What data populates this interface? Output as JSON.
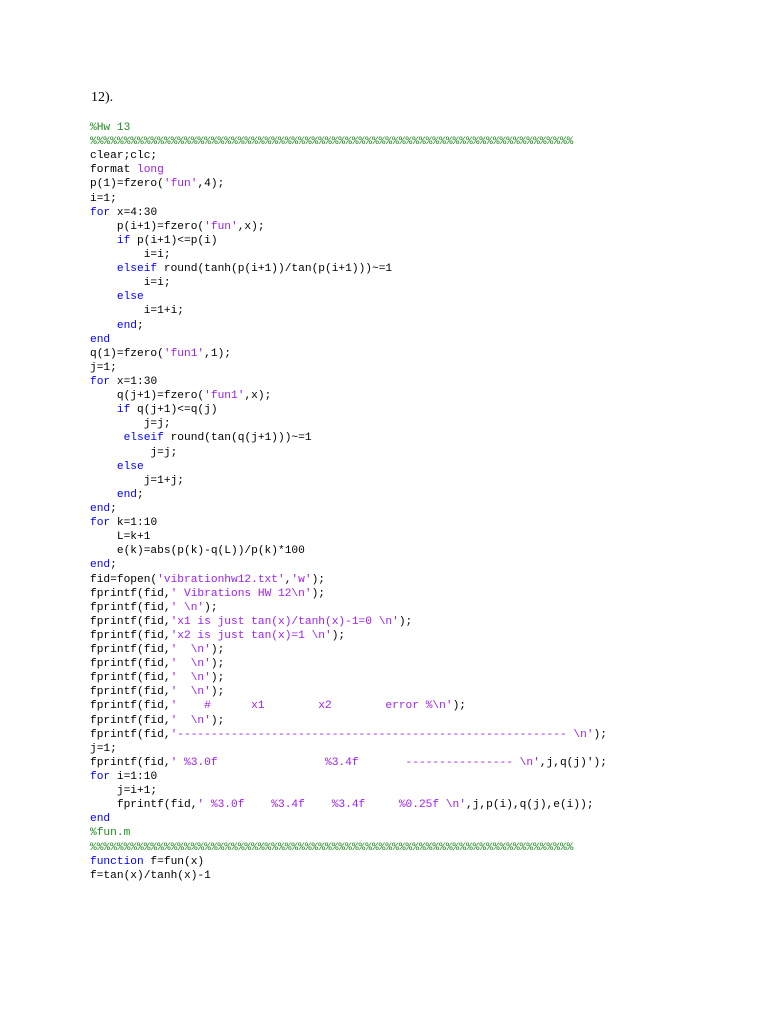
{
  "document": {
    "heading": "12).",
    "colors": {
      "keyword": "#0000ff",
      "string": "#a020f0",
      "comment": "#228b22",
      "text": "#000000"
    },
    "code_lines": [
      [
        [
          "c",
          "%Hw 13"
        ]
      ],
      [
        [
          "c",
          "%%%%%%%%%%%%%%%%%%%%%%%%%%%%%%%%%%%%%%%%%%%%%%%%%%%%%%%%%%%%%%%%%%%%%%%%"
        ]
      ],
      [
        [
          "n",
          "clear;clc;"
        ]
      ],
      [
        [
          "n",
          "format "
        ],
        [
          "s",
          "long"
        ]
      ],
      [
        [
          "n",
          "p(1)=fzero("
        ],
        [
          "s",
          "'fun'"
        ],
        [
          "n",
          ",4);"
        ]
      ],
      [
        [
          "n",
          "i=1;"
        ]
      ],
      [
        [
          "k",
          "for"
        ],
        [
          "n",
          " x=4:30"
        ]
      ],
      [
        [
          "n",
          "    p(i+1)=fzero("
        ],
        [
          "s",
          "'fun'"
        ],
        [
          "n",
          ",x);"
        ]
      ],
      [
        [
          "n",
          "    "
        ],
        [
          "k",
          "if"
        ],
        [
          "n",
          " p(i+1)<=p(i)"
        ]
      ],
      [
        [
          "n",
          "        i=i;"
        ]
      ],
      [
        [
          "n",
          "    "
        ],
        [
          "k",
          "elseif"
        ],
        [
          "n",
          " round(tanh(p(i+1))/tan(p(i+1)))~=1"
        ]
      ],
      [
        [
          "n",
          "        i=i;"
        ]
      ],
      [
        [
          "n",
          "    "
        ],
        [
          "k",
          "else"
        ]
      ],
      [
        [
          "n",
          "        i=1+i;"
        ]
      ],
      [
        [
          "n",
          "    "
        ],
        [
          "k",
          "end"
        ],
        [
          "n",
          ";"
        ]
      ],
      [
        [
          "k",
          "end"
        ]
      ],
      [
        [
          "n",
          "q(1)=fzero("
        ],
        [
          "s",
          "'fun1'"
        ],
        [
          "n",
          ",1);"
        ]
      ],
      [
        [
          "n",
          "j=1;"
        ]
      ],
      [
        [
          "k",
          "for"
        ],
        [
          "n",
          " x=1:30"
        ]
      ],
      [
        [
          "n",
          "    q(j+1)=fzero("
        ],
        [
          "s",
          "'fun1'"
        ],
        [
          "n",
          ",x);"
        ]
      ],
      [
        [
          "n",
          "    "
        ],
        [
          "k",
          "if"
        ],
        [
          "n",
          " q(j+1)<=q(j)"
        ]
      ],
      [
        [
          "n",
          "        j=j;"
        ]
      ],
      [
        [
          "n",
          "     "
        ],
        [
          "k",
          "elseif"
        ],
        [
          "n",
          " round(tan(q(j+1)))~=1"
        ]
      ],
      [
        [
          "n",
          "         j=j;"
        ]
      ],
      [
        [
          "n",
          "    "
        ],
        [
          "k",
          "else"
        ]
      ],
      [
        [
          "n",
          "        j=1+j;"
        ]
      ],
      [
        [
          "n",
          "    "
        ],
        [
          "k",
          "end"
        ],
        [
          "n",
          ";"
        ]
      ],
      [
        [
          "k",
          "end"
        ],
        [
          "n",
          ";"
        ]
      ],
      [
        [
          "k",
          "for"
        ],
        [
          "n",
          " k=1:10"
        ]
      ],
      [
        [
          "n",
          "    L=k+1"
        ]
      ],
      [
        [
          "n",
          "    e(k)=abs(p(k)-q(L))/p(k)*100"
        ]
      ],
      [
        [
          "k",
          "end"
        ],
        [
          "n",
          ";"
        ]
      ],
      [
        [
          "n",
          "fid=fopen("
        ],
        [
          "s",
          "'vibrationhw12.txt'"
        ],
        [
          "n",
          ","
        ],
        [
          "s",
          "'w'"
        ],
        [
          "n",
          ");"
        ]
      ],
      [
        [
          "n",
          "fprintf(fid,"
        ],
        [
          "s",
          "' Vibrations HW 12\\n'"
        ],
        [
          "n",
          ");"
        ]
      ],
      [
        [
          "n",
          "fprintf(fid,"
        ],
        [
          "s",
          "' \\n'"
        ],
        [
          "n",
          ");"
        ]
      ],
      [
        [
          "n",
          "fprintf(fid,"
        ],
        [
          "s",
          "'x1 is just tan(x)/tanh(x)-1=0 \\n'"
        ],
        [
          "n",
          ");"
        ]
      ],
      [
        [
          "n",
          "fprintf(fid,"
        ],
        [
          "s",
          "'x2 is just tan(x)=1 \\n'"
        ],
        [
          "n",
          ");"
        ]
      ],
      [
        [
          "n",
          "fprintf(fid,"
        ],
        [
          "s",
          "'  \\n'"
        ],
        [
          "n",
          ");"
        ]
      ],
      [
        [
          "n",
          "fprintf(fid,"
        ],
        [
          "s",
          "'  \\n'"
        ],
        [
          "n",
          ");"
        ]
      ],
      [
        [
          "n",
          "fprintf(fid,"
        ],
        [
          "s",
          "'  \\n'"
        ],
        [
          "n",
          ");"
        ]
      ],
      [
        [
          "n",
          "fprintf(fid,"
        ],
        [
          "s",
          "'  \\n'"
        ],
        [
          "n",
          ");"
        ]
      ],
      [
        [
          "n",
          "fprintf(fid,"
        ],
        [
          "s",
          "'    #      x1        x2        error %\\n'"
        ],
        [
          "n",
          ");"
        ]
      ],
      [
        [
          "n",
          "fprintf(fid,"
        ],
        [
          "s",
          "'  \\n'"
        ],
        [
          "n",
          ");"
        ]
      ],
      [
        [
          "n",
          "fprintf(fid,"
        ],
        [
          "s",
          "'---------------------------------------------------------- \\n'"
        ],
        [
          "n",
          ");"
        ]
      ],
      [
        [
          "n",
          "j=1;"
        ]
      ],
      [
        [
          "n",
          "fprintf(fid,"
        ],
        [
          "s",
          "' %3.0f                %3.4f       ---------------- \\n'"
        ],
        [
          "n",
          ",j,q(j)');"
        ]
      ],
      [
        [
          "k",
          "for"
        ],
        [
          "n",
          " i=1:10"
        ]
      ],
      [
        [
          "n",
          "    j=i+1;"
        ]
      ],
      [
        [
          "n",
          "    fprintf(fid,"
        ],
        [
          "s",
          "' %3.0f    %3.4f    %3.4f     %0.25f \\n'"
        ],
        [
          "n",
          ",j,p(i),q(j),e(i));"
        ]
      ],
      [
        [
          "k",
          "end"
        ]
      ],
      [
        [
          "c",
          "%fun.m"
        ]
      ],
      [
        [
          "c",
          "%%%%%%%%%%%%%%%%%%%%%%%%%%%%%%%%%%%%%%%%%%%%%%%%%%%%%%%%%%%%%%%%%%%%%%%%"
        ]
      ],
      [
        [
          "k",
          "function"
        ],
        [
          "n",
          " f=fun(x)"
        ]
      ],
      [
        [
          "n",
          "f=tan(x)/tanh(x)-1"
        ]
      ]
    ]
  }
}
